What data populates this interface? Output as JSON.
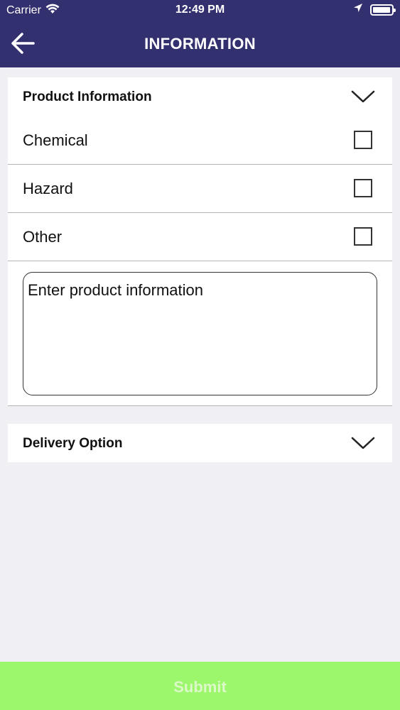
{
  "status_bar": {
    "carrier": "Carrier",
    "time": "12:49 PM"
  },
  "nav": {
    "title": "INFORMATION"
  },
  "product_section": {
    "title": "Product Information",
    "options": [
      {
        "label": "Chemical",
        "checked": false
      },
      {
        "label": "Hazard",
        "checked": false
      },
      {
        "label": "Other",
        "checked": false
      }
    ],
    "input_placeholder": "Enter product information"
  },
  "delivery_section": {
    "title": "Delivery Option"
  },
  "submit": {
    "label": "Submit"
  },
  "colors": {
    "nav_bg": "#33306f",
    "page_bg": "#efeff4",
    "submit_bg": "#9cf76c",
    "submit_text": "#dcf8c8"
  }
}
